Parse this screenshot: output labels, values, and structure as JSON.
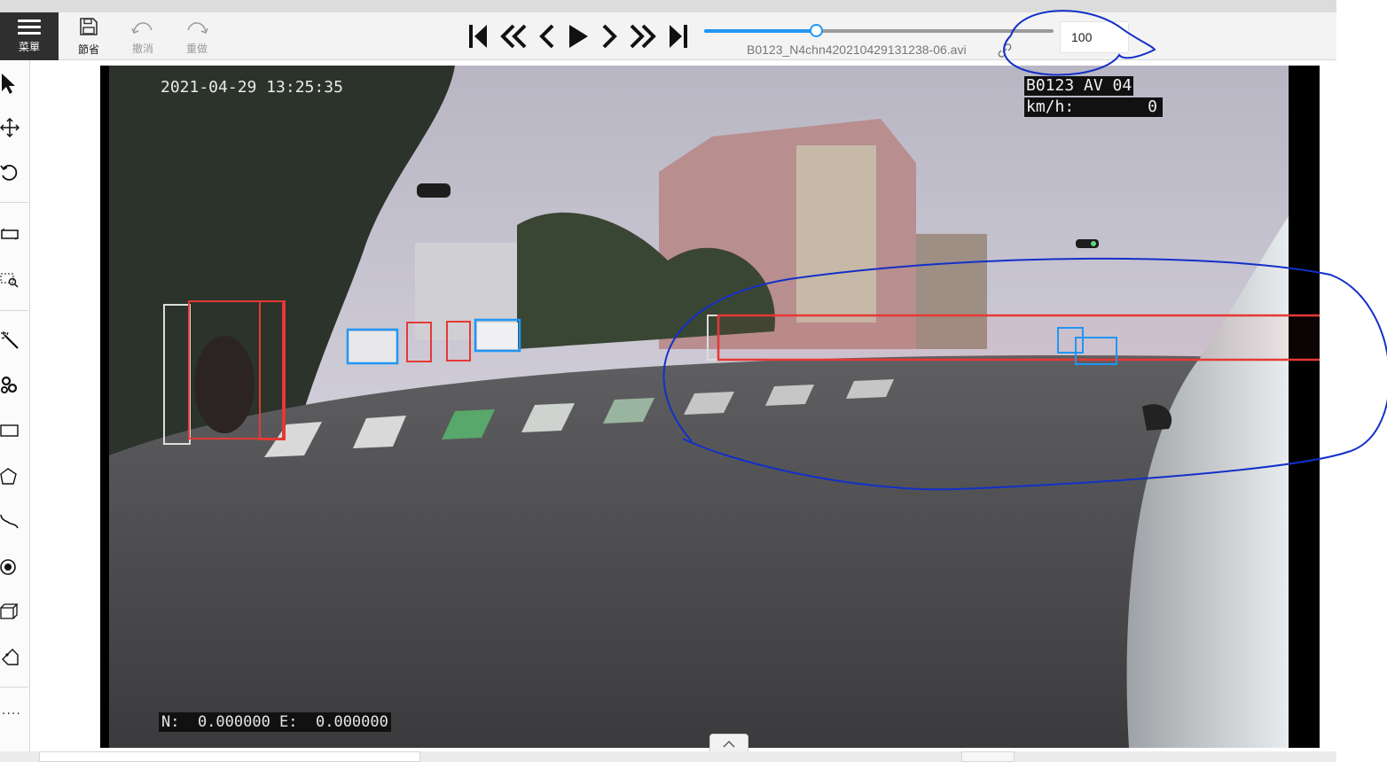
{
  "toolbar": {
    "menu_label": "菜單",
    "save_label": "節省",
    "undo_label": "撤消",
    "redo_label": "重做"
  },
  "player": {
    "filename": "B0123_N4chn420210429131238-06.avi",
    "frame_value": "100",
    "progress": 0.32
  },
  "video": {
    "timestamp": "2021-04-29 13:25:35",
    "device_id": "B0123 AV 04",
    "speed_label": "km/h:",
    "speed_value": "0",
    "gps_text": "N:  0.000000 E:  0.000000"
  },
  "icons": {
    "menu": "hamburger-icon",
    "save": "floppy-disk-icon",
    "undo": "undo-arc-icon",
    "redo": "redo-arc-icon",
    "link": "link-chain-icon"
  },
  "colors": {
    "accent": "#2196f3",
    "annotation_ink": "#1230c8",
    "box_red": "#e53935",
    "box_blue": "#2196f3",
    "box_white": "#dddddd"
  }
}
